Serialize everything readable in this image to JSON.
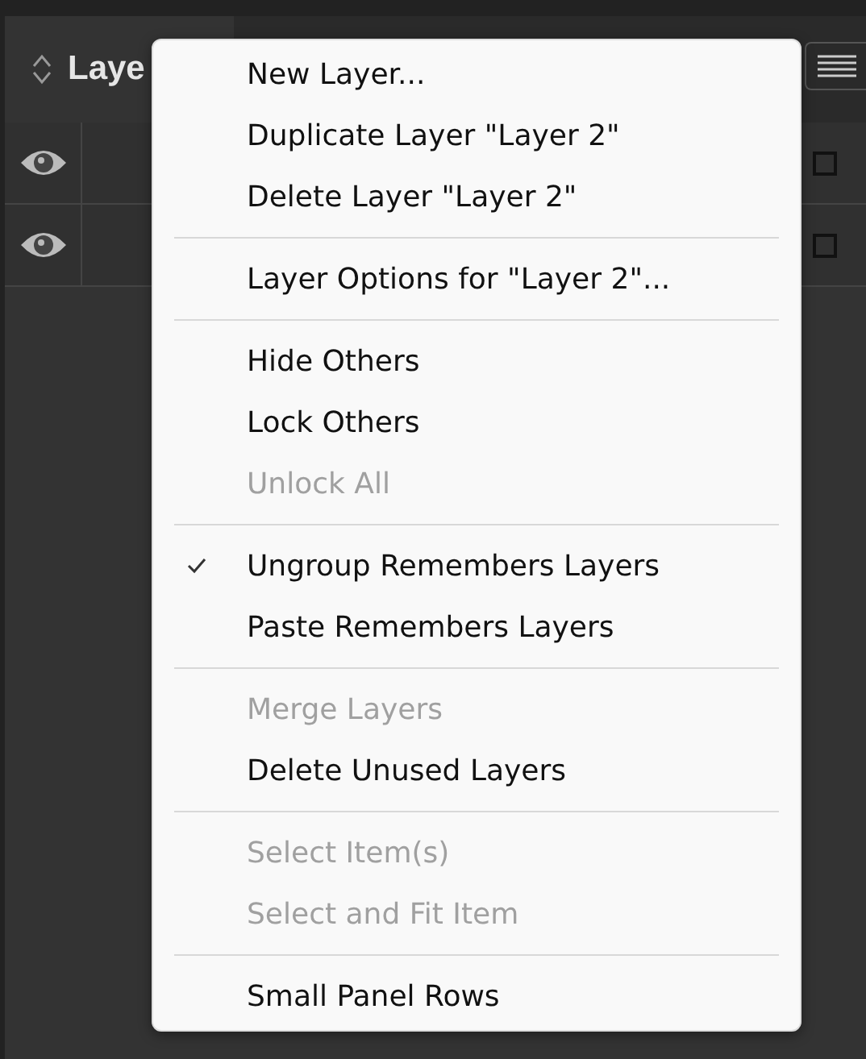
{
  "panel": {
    "tab_title": "Laye",
    "layers": [
      {
        "visible": true,
        "checked": false
      },
      {
        "visible": true,
        "checked": false
      }
    ]
  },
  "menu": {
    "groups": [
      [
        {
          "label": "New Layer...",
          "disabled": false,
          "checked": false
        },
        {
          "label": "Duplicate Layer \"Layer 2\"",
          "disabled": false,
          "checked": false
        },
        {
          "label": "Delete Layer \"Layer 2\"",
          "disabled": false,
          "checked": false
        }
      ],
      [
        {
          "label": "Layer Options for \"Layer 2\"...",
          "disabled": false,
          "checked": false
        }
      ],
      [
        {
          "label": "Hide Others",
          "disabled": false,
          "checked": false
        },
        {
          "label": "Lock Others",
          "disabled": false,
          "checked": false
        },
        {
          "label": "Unlock All",
          "disabled": true,
          "checked": false
        }
      ],
      [
        {
          "label": "Ungroup Remembers Layers",
          "disabled": false,
          "checked": true
        },
        {
          "label": "Paste Remembers Layers",
          "disabled": false,
          "checked": false
        }
      ],
      [
        {
          "label": "Merge Layers",
          "disabled": true,
          "checked": false
        },
        {
          "label": "Delete Unused Layers",
          "disabled": false,
          "checked": false
        }
      ],
      [
        {
          "label": "Select Item(s)",
          "disabled": true,
          "checked": false
        },
        {
          "label": "Select and Fit Item",
          "disabled": true,
          "checked": false
        }
      ],
      [
        {
          "label": "Small Panel Rows",
          "disabled": false,
          "checked": false
        }
      ]
    ]
  }
}
